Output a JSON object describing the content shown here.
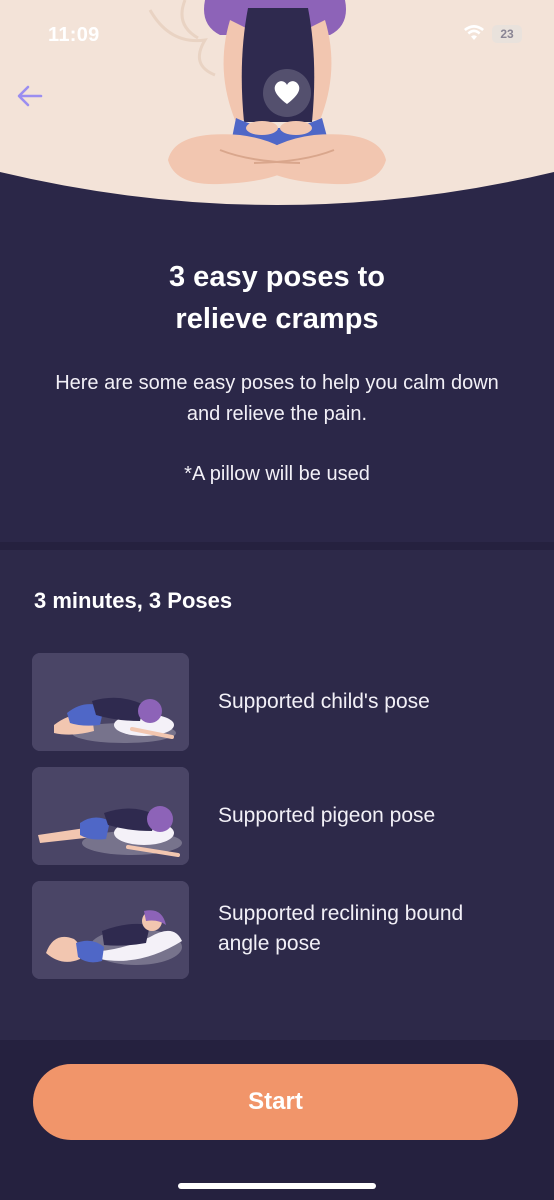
{
  "status_bar": {
    "time": "11:09",
    "battery": "23",
    "wifi_icon": "wifi-icon"
  },
  "header": {
    "back_icon": "back-arrow-icon",
    "illustration": "meditating-woman-illustration"
  },
  "intro": {
    "title_line1": "3 easy poses to",
    "title_line2": "relieve cramps",
    "description": "Here are some easy poses to help you calm down and relieve the pain.",
    "note": "*A pillow will be used"
  },
  "poses": {
    "heading": "3 minutes, 3 Poses",
    "items": [
      {
        "label": "Supported child's pose",
        "image": "childs-pose-image"
      },
      {
        "label": "Supported pigeon pose",
        "image": "pigeon-pose-image"
      },
      {
        "label": "Supported reclining bound angle pose",
        "image": "reclining-bound-angle-pose-image"
      }
    ]
  },
  "footer": {
    "start_label": "Start"
  },
  "colors": {
    "background": "#2b2748",
    "hero_background": "#f3e3d8",
    "accent": "#f1956a",
    "back_arrow": "#9b8ef0"
  }
}
